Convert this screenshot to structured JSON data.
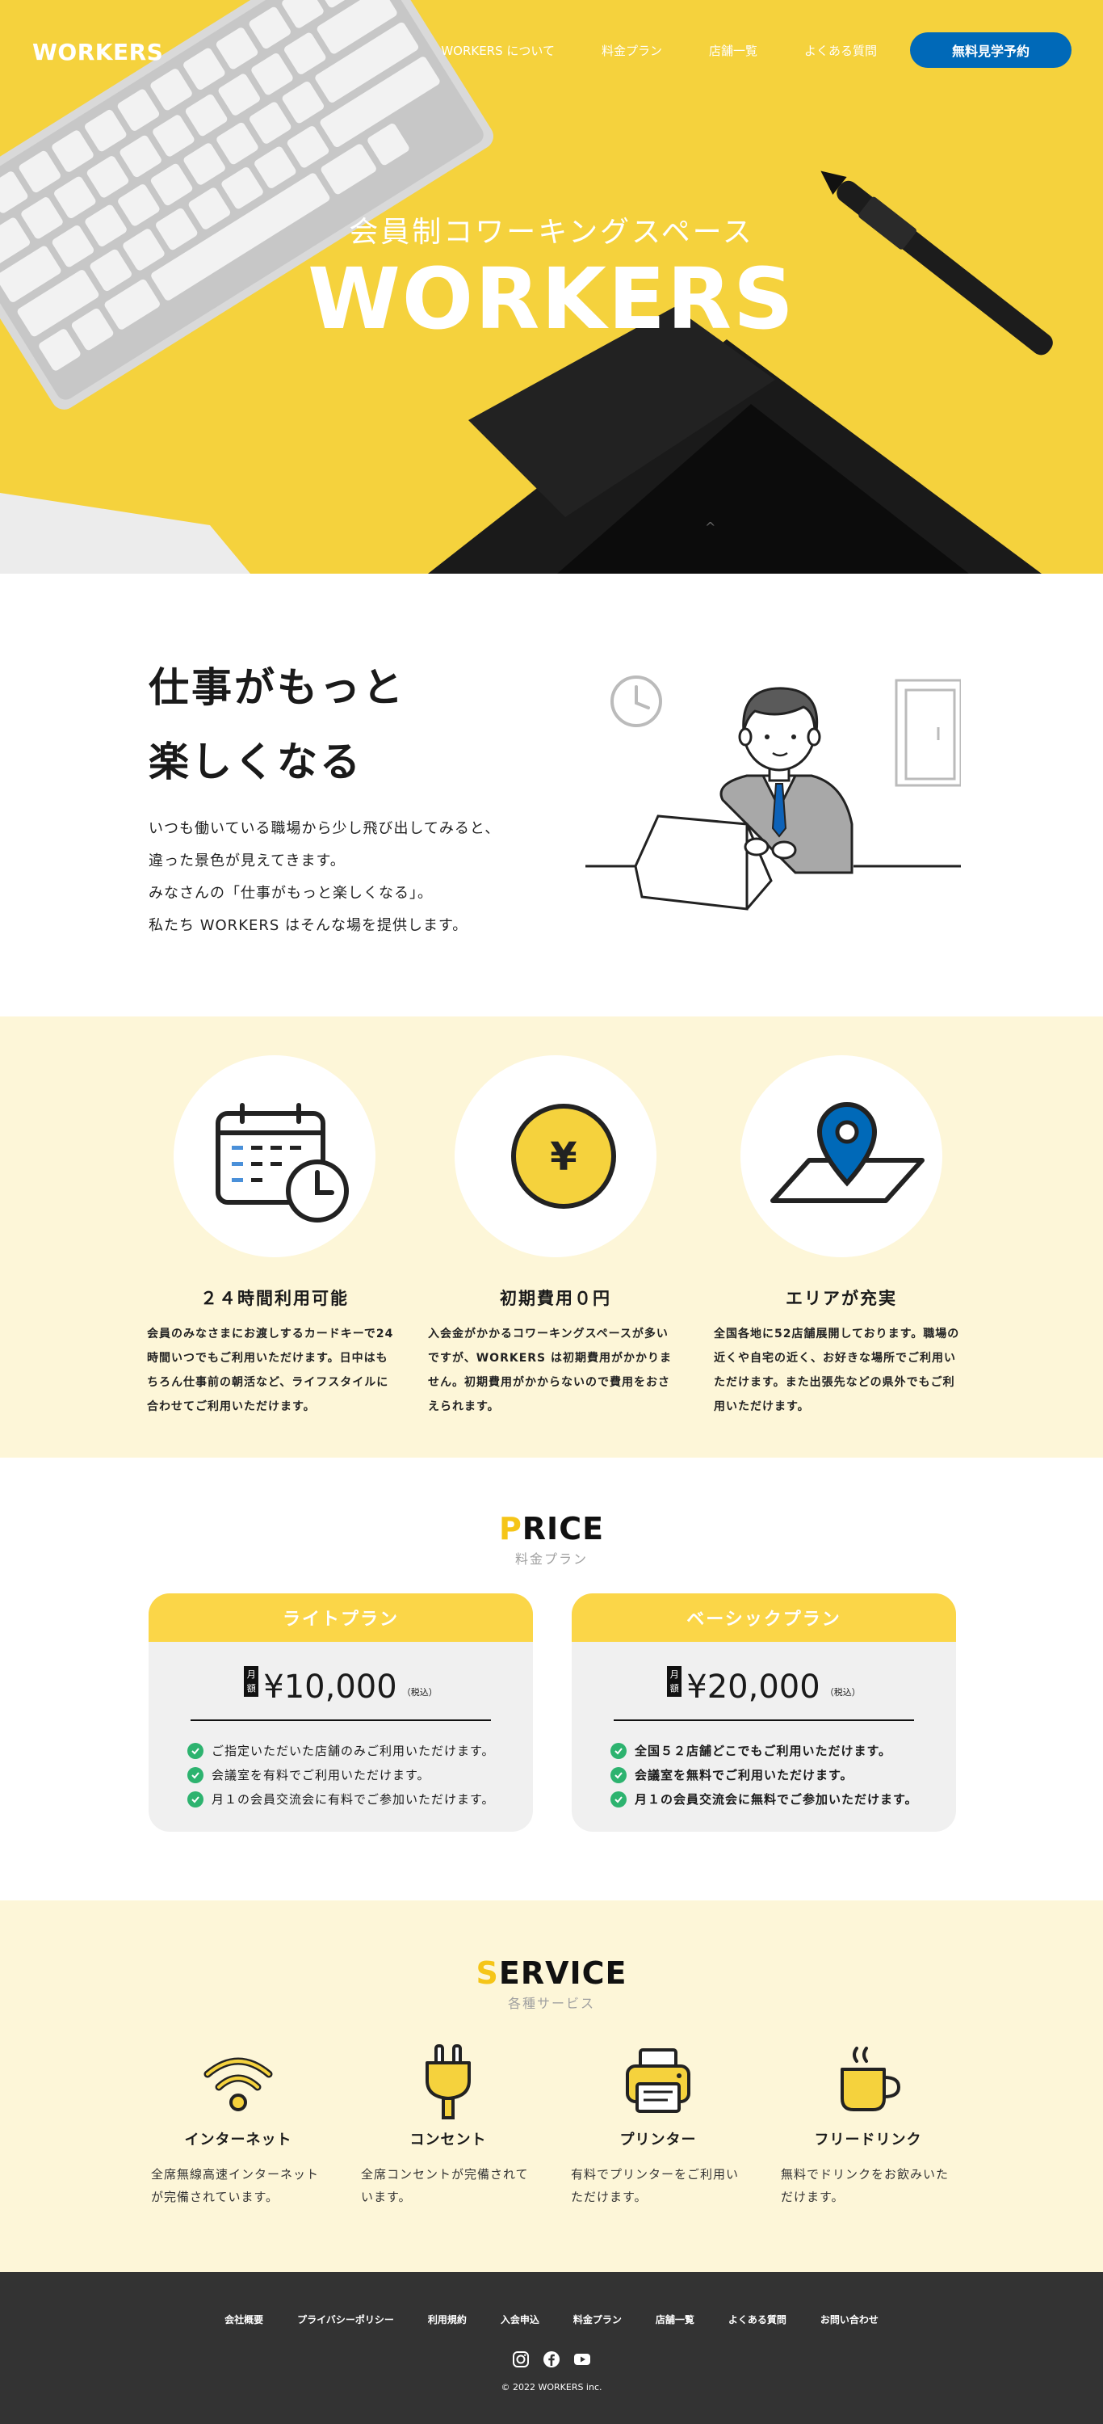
{
  "header": {
    "logo": "WORKERS",
    "nav": [
      "WORKERS について",
      "料金プラン",
      "店舗一覧",
      "よくある質問"
    ],
    "cta": "無料見学予約"
  },
  "hero": {
    "subtitle": "会員制コワーキングスペース",
    "title": "WORKERS",
    "scroll_glyph": "^"
  },
  "intro": {
    "title_line1": "仕事がもっと",
    "title_line2": "楽しくなる",
    "text": [
      "いつも働いている職場から少し飛び出してみると、",
      "違った景色が見えてきます。",
      "みなさんの「仕事がもっと楽しくなる」。",
      "私たち WORKERS はそんな場を提供します。"
    ]
  },
  "features": [
    {
      "icon": "calendar-clock-icon",
      "title": "２４時間利用可能",
      "text": "会員のみなさまにお渡しするカードキーで24時間いつでもご利用いただけます。日中はもちろん仕事前の朝活など、ライフスタイルに合わせてご利用いただけます。"
    },
    {
      "icon": "yen-coin-icon",
      "title": "初期費用０円",
      "text": "入会金がかかるコワーキングスペースが多いですが、WORKERS は初期費用がかかりません。初期費用がかからないので費用をおさえられます。"
    },
    {
      "icon": "map-pin-icon",
      "title": "エリアが充実",
      "text": "全国各地に52店舗展開しております。職場の近くや自宅の近く、お好きな場所でご利用いただけます。また出張先などの県外でもご利用いただけます。"
    }
  ],
  "price": {
    "heading_first": "P",
    "heading_rest": "RICE",
    "sub": "料金プラン",
    "plans": [
      {
        "name": "ライトプラン",
        "month_tag": "月額",
        "amount": "¥10,000",
        "tax": "（税込）",
        "items": [
          "ご指定いただいた店舗のみご利用いただけます。",
          "会議室を有料でご利用いただけます。",
          "月１の会員交流会に有料でご参加いただけます。"
        ]
      },
      {
        "name": "ベーシックプラン",
        "month_tag": "月額",
        "amount": "¥20,000",
        "tax": "（税込）",
        "items": [
          "全国５２店舗どこでもご利用いただけます。",
          "会議室を無料でご利用いただけます。",
          "月１の会員交流会に無料でご参加いただけます。"
        ]
      }
    ]
  },
  "service": {
    "heading_first": "S",
    "heading_rest": "ERVICE",
    "sub": "各種サービス",
    "items": [
      {
        "icon": "wifi-icon",
        "title": "インターネット",
        "text": "全席無線高速インターネットが完備されています。"
      },
      {
        "icon": "plug-icon",
        "title": "コンセント",
        "text": "全席コンセントが完備されています。"
      },
      {
        "icon": "printer-icon",
        "title": "プリンター",
        "text": "有料でプリンターをご利用いただけます。"
      },
      {
        "icon": "coffee-icon",
        "title": "フリードリンク",
        "text": "無料でドリンクをお飲みいただけます。"
      }
    ]
  },
  "footer": {
    "nav": [
      "会社概要",
      "プライバシーポリシー",
      "利用規約",
      "入会申込",
      "料金プラン",
      "店舗一覧",
      "よくある質問",
      "お問い合わせ"
    ],
    "social": [
      "instagram-icon",
      "facebook-icon",
      "youtube-icon"
    ],
    "copyright": "© 2022 WORKERS inc."
  },
  "colors": {
    "accent_yellow": "#f5d23d",
    "cta_blue": "#0069b8",
    "feature_bg": "#fdf6d8",
    "check_green": "#2db36f",
    "footer_bg": "#333333"
  }
}
